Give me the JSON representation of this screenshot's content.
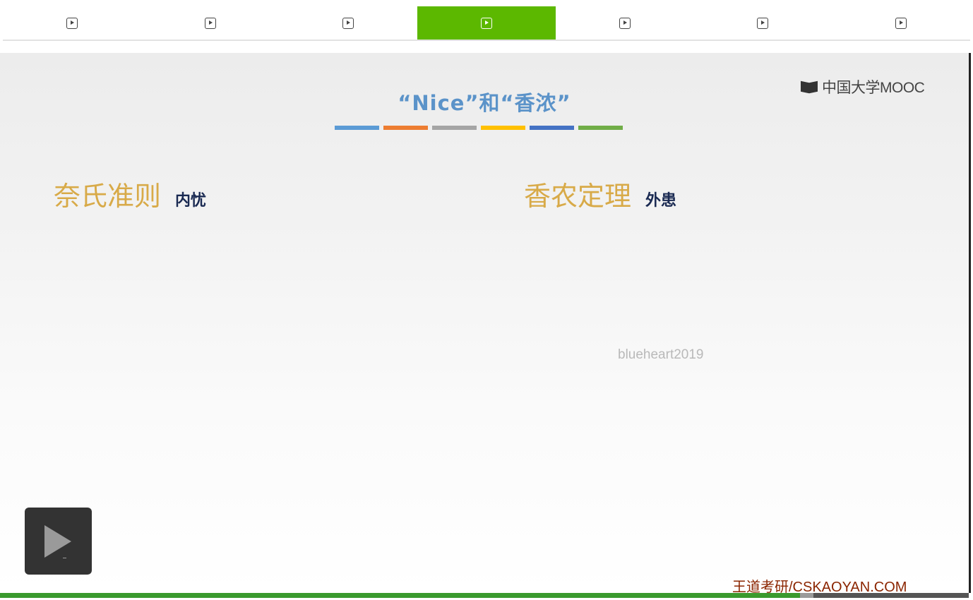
{
  "tabs": [
    {
      "icon": "play-square-icon",
      "active": false
    },
    {
      "icon": "play-square-icon",
      "active": false
    },
    {
      "icon": "play-square-icon",
      "active": false
    },
    {
      "icon": "play-square-icon",
      "active": true
    },
    {
      "icon": "play-square-icon",
      "active": false
    },
    {
      "icon": "play-square-icon",
      "active": false
    },
    {
      "icon": "play-square-icon",
      "active": false
    }
  ],
  "colors": {
    "active_tab": "#5cb800",
    "title": "#5b93c9",
    "gold": "#d8aa48",
    "navy": "#1a2a52",
    "brand": "#8b2500"
  },
  "slide": {
    "logo_text": "中国大学MOOC",
    "title": "“Nice”和“香浓”",
    "color_bars": [
      "#5b9bd5",
      "#ed7d31",
      "#a5a5a5",
      "#ffc000",
      "#4472c4",
      "#70ad47"
    ],
    "left": {
      "heading": "奈氏准则",
      "subheading": "内忧"
    },
    "right": {
      "heading": "香农定理",
      "subheading": "外患"
    },
    "watermark": "blueheart2019",
    "brand": "王道考研/CSKAOYAN.COM"
  },
  "player": {
    "play_icon": "play-icon",
    "progress": 0.826,
    "buffered": 0.84
  }
}
